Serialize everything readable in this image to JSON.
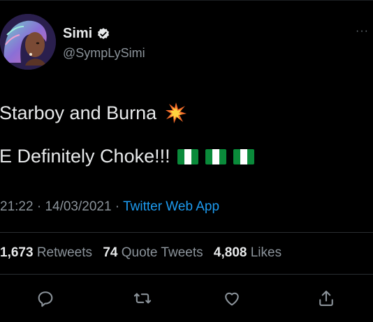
{
  "author": {
    "name": "Simi",
    "handle": "@SympLySimi",
    "verified": true
  },
  "tweet": {
    "line1": "Starboy and Burna",
    "line2": "E Definitely Choke!!!",
    "emoji": [
      "collision-icon",
      "nigeria-flag-icon",
      "nigeria-flag-icon",
      "nigeria-flag-icon"
    ]
  },
  "meta": {
    "time": "21:22",
    "separator": " · ",
    "date": "14/03/2021",
    "source": "Twitter Web App"
  },
  "stats": {
    "retweets_count": "1,673",
    "retweets_label": "Retweets",
    "quotes_count": "74",
    "quotes_label": "Quote Tweets",
    "likes_count": "4,808",
    "likes_label": "Likes"
  },
  "colors": {
    "background": "#000000",
    "text": "#e7e9ea",
    "secondary": "#8b939a",
    "link": "#1d9bf0",
    "flag_green": "#0a8a3a"
  },
  "more_glyph": "···"
}
